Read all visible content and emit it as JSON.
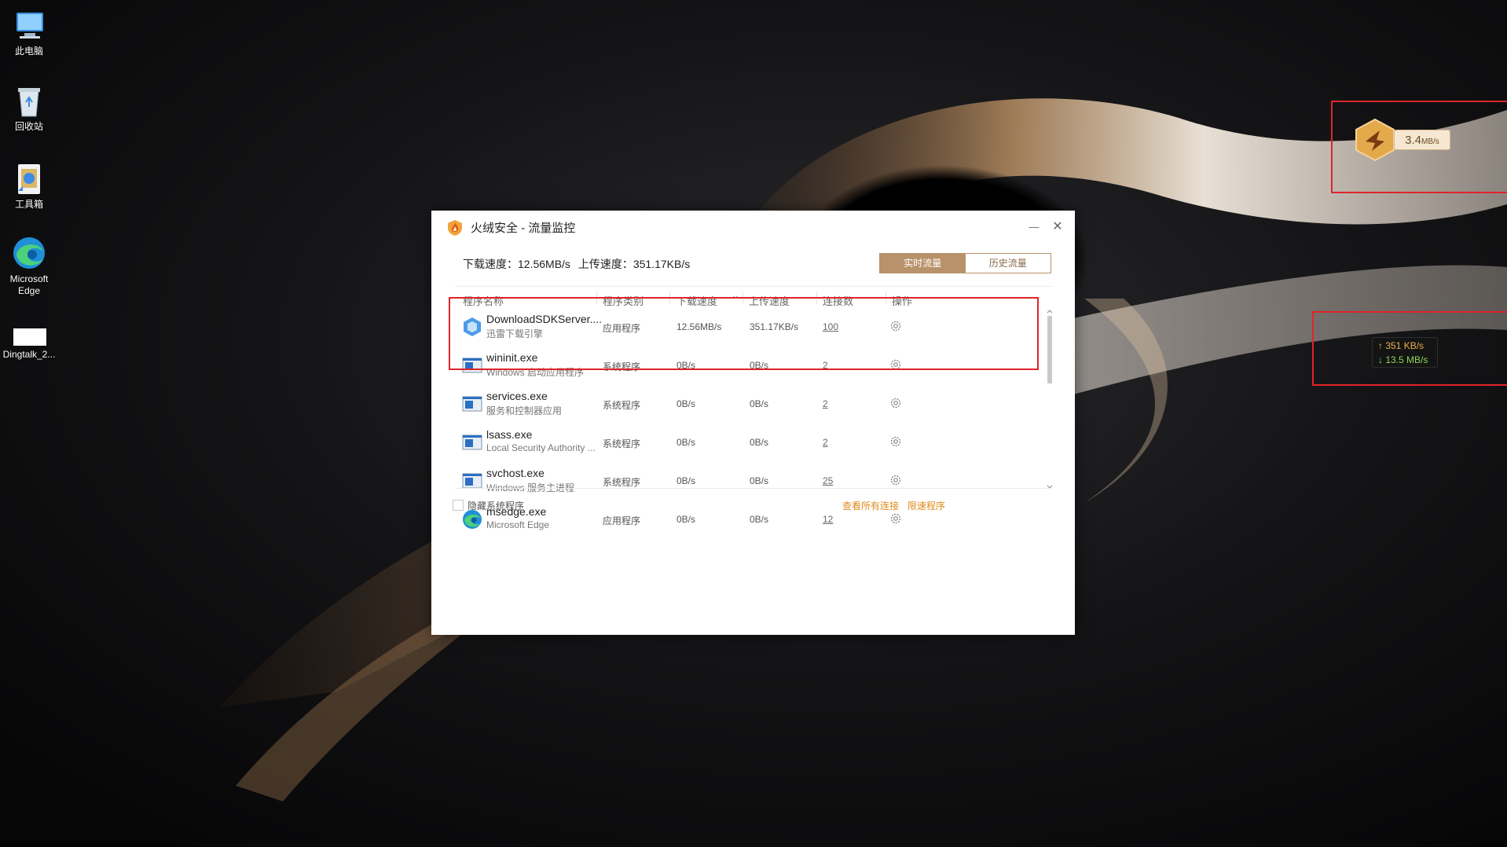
{
  "desktop": {
    "icons": [
      {
        "label": "此电脑",
        "icon": "computer-icon"
      },
      {
        "label": "回收站",
        "icon": "recycle-bin-icon"
      },
      {
        "label": "工具箱",
        "icon": "toolbox-icon"
      },
      {
        "label": "Microsoft Edge",
        "icon": "edge-icon"
      },
      {
        "label": "Dingtalk_2...",
        "icon": "file-icon"
      }
    ]
  },
  "window": {
    "title": "火绒安全 - 流量监控",
    "minimize_glyph": "—",
    "close_glyph": "✕",
    "stats": {
      "download": "下载速度：12.56MB/s",
      "upload": "上传速度：351.17KB/s"
    },
    "tabs": [
      {
        "label": "实时流量",
        "active": true
      },
      {
        "label": "历史流量",
        "active": false
      }
    ],
    "columns": [
      "程序名称",
      "程序类别",
      "下载速度",
      "上传速度",
      "连接数",
      "操作"
    ],
    "sort_indicator": "⌄",
    "rows": [
      {
        "name": "DownloadSDKServer....",
        "desc": "迅雷下载引擎",
        "category": "应用程序",
        "down": "12.56MB/s",
        "up": "351.17KB/s",
        "conns": "100",
        "icon": "thunder-icon"
      },
      {
        "name": "wininit.exe",
        "desc": "Windows 启动应用程序",
        "category": "系统程序",
        "down": "0B/s",
        "up": "0B/s",
        "conns": "2",
        "icon": "window-app-icon"
      },
      {
        "name": "services.exe",
        "desc": "服务和控制器应用",
        "category": "系统程序",
        "down": "0B/s",
        "up": "0B/s",
        "conns": "2",
        "icon": "window-app-icon"
      },
      {
        "name": "lsass.exe",
        "desc": "Local Security Authority ...",
        "category": "系统程序",
        "down": "0B/s",
        "up": "0B/s",
        "conns": "2",
        "icon": "window-app-icon"
      },
      {
        "name": "svchost.exe",
        "desc": "Windows 服务主进程",
        "category": "系统程序",
        "down": "0B/s",
        "up": "0B/s",
        "conns": "25",
        "icon": "window-app-icon"
      },
      {
        "name": "msedge.exe",
        "desc": "Microsoft Edge",
        "category": "应用程序",
        "down": "0B/s",
        "up": "0B/s",
        "conns": "12",
        "icon": "edge-icon"
      }
    ],
    "footer": {
      "hide_system_label": "隐藏系统程序",
      "hide_system_checked": false,
      "view_all_connections": "查看所有连接",
      "limit_programs": "限速程序"
    }
  },
  "widgets": {
    "fox_speed_value": "3.4",
    "fox_speed_unit": "MB/s",
    "net_up": "↑ 351 KB/s",
    "net_down": "↓ 13.5 MB/s"
  },
  "colors": {
    "accent": "#b8926a",
    "link": "#e08a1a",
    "annotation_red": "#e0242a"
  }
}
